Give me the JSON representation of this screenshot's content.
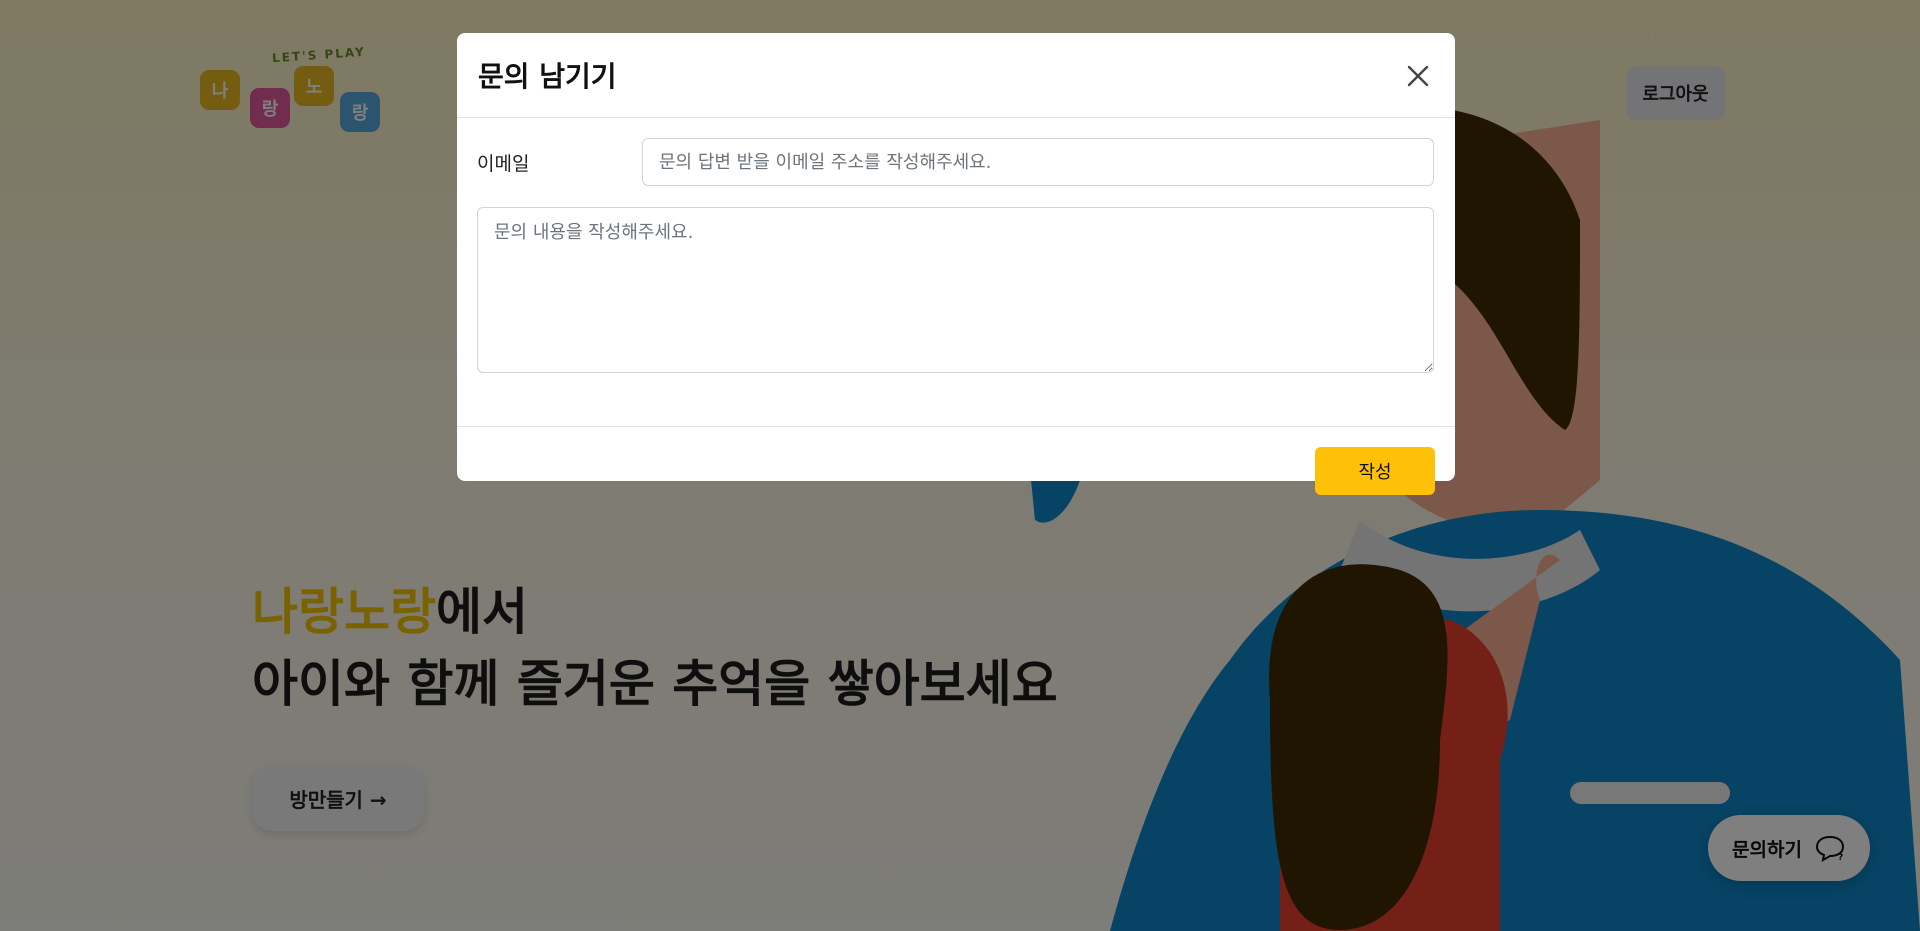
{
  "header": {
    "logo_tag": "LET'S PLAY",
    "logo_tiles": [
      "나",
      "랑",
      "노",
      "랑"
    ],
    "logout_label": "로그아웃"
  },
  "hero": {
    "brand": "나랑노랑",
    "line1_suffix": "에서",
    "line2": "아이와 함께 즐거운 추억을 쌓아보세요",
    "room_button_label": "방만들기 →"
  },
  "floating": {
    "inquiry_label": "문의하기",
    "icon": "chat-bubble-icon"
  },
  "modal": {
    "title": "문의 남기기",
    "email_label": "이메일",
    "email_placeholder": "문의 답변 받을 이메일 주소를 작성해주세요.",
    "content_placeholder": "문의 내용을 작성해주세요.",
    "submit_label": "작성",
    "close_icon": "close-icon"
  },
  "colors": {
    "brand_yellow": "#f3c400",
    "submit_button": "#ffc107",
    "overlay": "rgba(0,0,0,0.5)"
  }
}
